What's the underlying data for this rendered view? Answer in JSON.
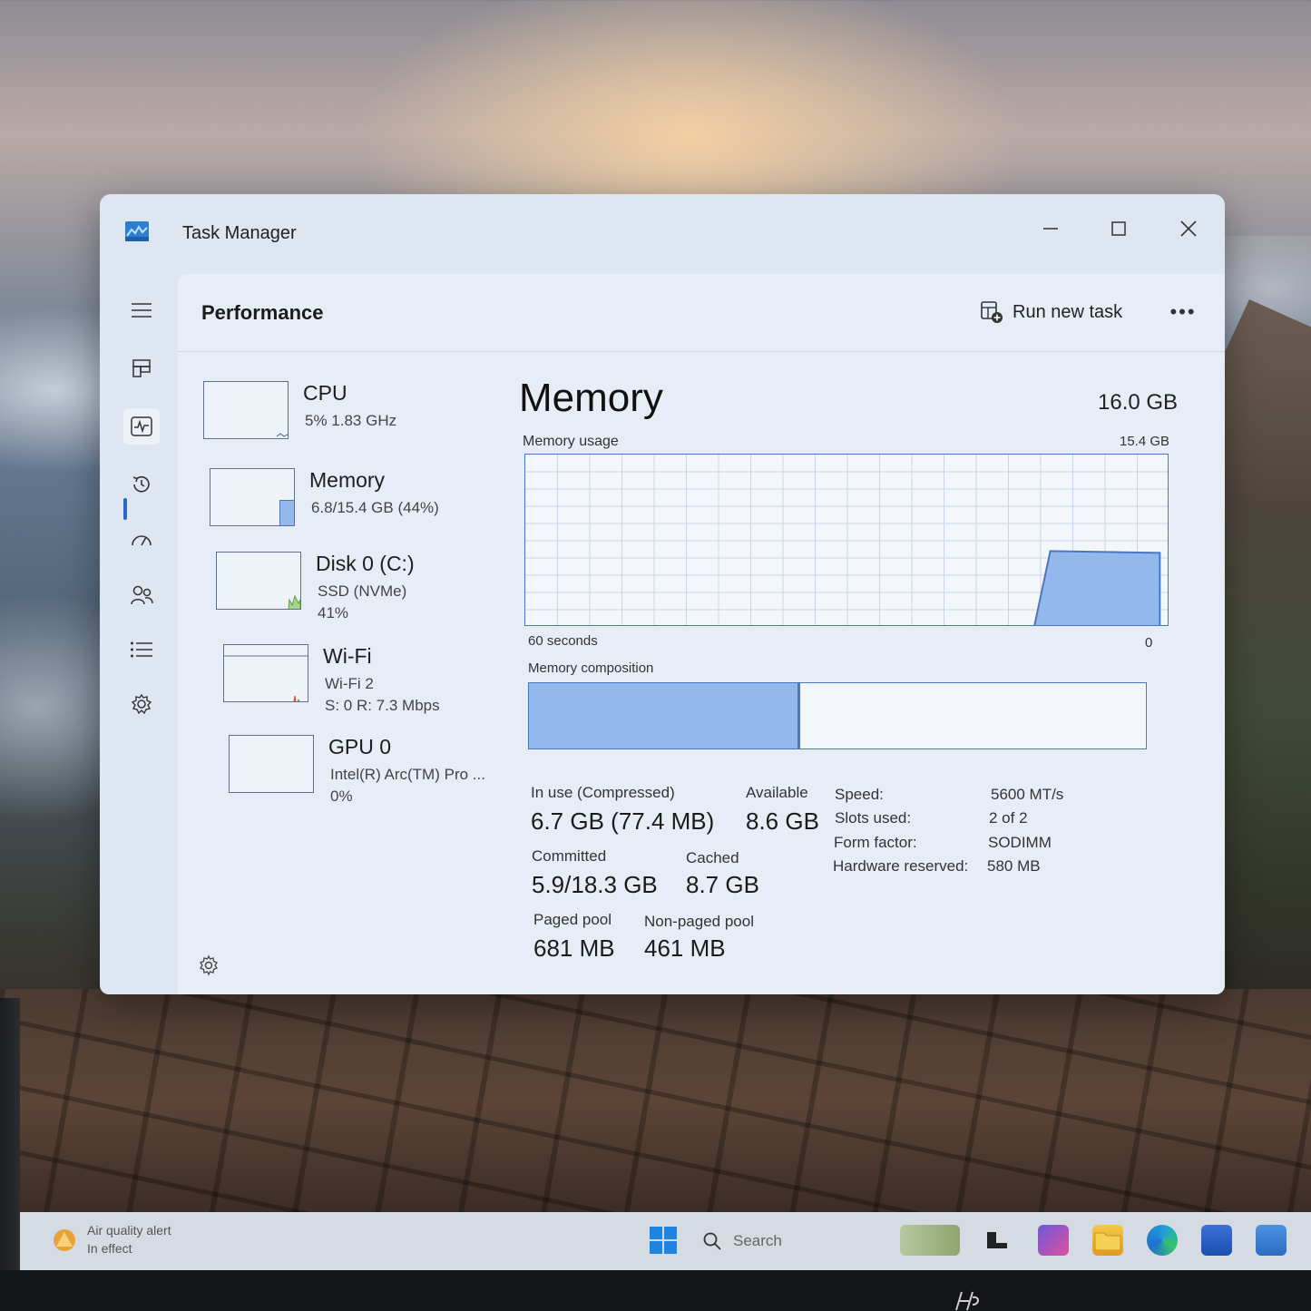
{
  "window": {
    "title": "Task Manager",
    "page_title": "Performance",
    "run_new_task": "Run new task",
    "more": "•••"
  },
  "nav_icons": [
    "hamburger-icon",
    "processes-icon",
    "performance-icon",
    "app-history-icon",
    "startup-apps-icon",
    "users-icon",
    "details-icon",
    "services-icon",
    "settings-icon"
  ],
  "devices": [
    {
      "name": "CPU",
      "sub1": "5%  1.83 GHz",
      "sub2": "",
      "usage": 0.05
    },
    {
      "name": "Memory",
      "sub1": "6.8/15.4 GB (44%)",
      "sub2": "",
      "usage": 0.44
    },
    {
      "name": "Disk 0 (C:)",
      "sub1": "SSD (NVMe)",
      "sub2": "41%",
      "usage": 0.41
    },
    {
      "name": "Wi-Fi",
      "sub1": "Wi-Fi 2",
      "sub2": "S: 0 R: 7.3 Mbps",
      "usage": 0.3
    },
    {
      "name": "GPU 0",
      "sub1": "Intel(R) Arc(TM) Pro ...",
      "sub2": "0%",
      "usage": 0.0
    }
  ],
  "memory": {
    "title": "Memory",
    "total": "16.0 GB",
    "usage_label": "Memory usage",
    "usage_max": "15.4 GB",
    "time_left": "60 seconds",
    "time_right": "0",
    "composition_label": "Memory composition",
    "in_use_fraction": 0.435,
    "stats": {
      "in_use_label": "In use (Compressed)",
      "in_use_value": "6.7 GB (77.4 MB)",
      "available_label": "Available",
      "available_value": "8.6 GB",
      "committed_label": "Committed",
      "committed_value": "5.9/18.3 GB",
      "cached_label": "Cached",
      "cached_value": "8.7 GB",
      "paged_label": "Paged pool",
      "paged_value": "681 MB",
      "nonpaged_label": "Non-paged pool",
      "nonpaged_value": "461 MB"
    },
    "specs": [
      {
        "label": "Speed:",
        "value": "5600 MT/s"
      },
      {
        "label": "Slots used:",
        "value": "2 of 2"
      },
      {
        "label": "Form factor:",
        "value": "SODIMM"
      },
      {
        "label": "Hardware reserved:",
        "value": "580 MB"
      }
    ]
  },
  "taskbar": {
    "weather_line1": "Air quality alert",
    "weather_line2": "In effect",
    "search_label": "Search"
  },
  "colors": {
    "accent": "#2b66c8",
    "graph_line": "#4a77c4",
    "graph_fill": "#93b8ec",
    "disk_fill": "#7bbf6a",
    "wifi_line": "#c2553a"
  }
}
